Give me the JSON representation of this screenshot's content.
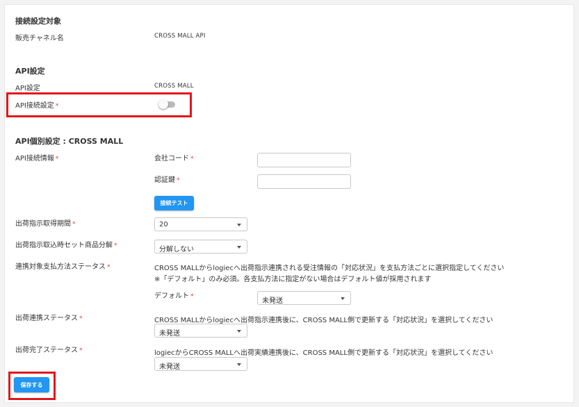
{
  "connection_target": {
    "title": "接続設定対象",
    "channel_label": "販売チャネル名",
    "channel_value": "CROSS MALL API"
  },
  "api_settings": {
    "title": "API設定",
    "api_label": "API設定",
    "api_value": "CROSS MALL",
    "connect_label": "API接続設定",
    "connect_enabled": false
  },
  "api_individual": {
    "title": "API個別設定 : CROSS MALL",
    "connect_info_label": "API接続情報",
    "company_code_label": "会社コード",
    "company_code_value": "",
    "auth_key_label": "認証鍵",
    "auth_key_value": "",
    "test_button": "接続テスト"
  },
  "fetch_period": {
    "label": "出荷指示取得期間",
    "value": "20"
  },
  "set_split": {
    "label": "出荷指示取込時セット商品分解",
    "value": "分解しない"
  },
  "payment_status": {
    "label": "連携対象支払方法ステータス",
    "desc1": "CROSS MALLからlogiecへ出荷指示連携される受注情報の「対応状況」を支払方法ごとに選択指定してください",
    "desc2": "※「デフォルト」のみ必須。各支払方法に指定がない場合はデフォルト値が採用されます",
    "default_label": "デフォルト",
    "default_value": "未発送"
  },
  "ship_link_status": {
    "label": "出荷連携ステータス",
    "desc": "CROSS MALLからlogiecへ出荷指示連携後に、CROSS MALL側で更新する「対応状況」を選択してください",
    "value": "未発送"
  },
  "ship_done_status": {
    "label": "出荷完了ステータス",
    "desc": "logiecからCROSS MALLへ出荷実績連携後に、CROSS MALL側で更新する「対応状況」を選択してください",
    "value": "未発送"
  },
  "save_button": "保存する",
  "required_mark": "*",
  "colors": {
    "primary": "#2196f3",
    "required": "#e53935",
    "highlight": "#e3141b"
  }
}
